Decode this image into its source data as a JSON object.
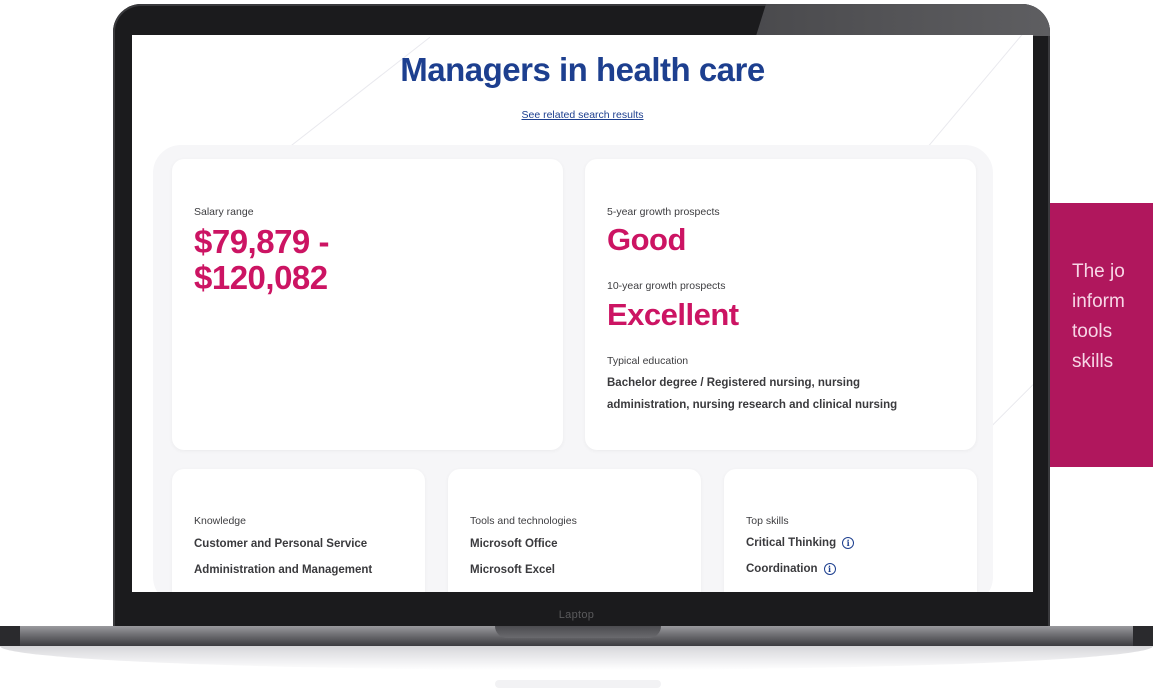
{
  "device": {
    "bezel_label": "Laptop"
  },
  "page": {
    "title": "Managers in health care",
    "related_link": "See related search results"
  },
  "salary": {
    "label": "Salary range",
    "line1": "$79,879 -",
    "line2": "$120,082"
  },
  "growth": {
    "five_label": "5-year growth prospects",
    "five_value": "Good",
    "ten_label": "10-year growth prospects",
    "ten_value": "Excellent",
    "education_label": "Typical education",
    "education_line1": "Bachelor degree / Registered nursing, nursing",
    "education_line2": "administration, nursing research and clinical nursing"
  },
  "knowledge": {
    "label": "Knowledge",
    "items": [
      "Customer and Personal Service",
      "Administration and Management"
    ]
  },
  "tools": {
    "label": "Tools and technologies",
    "items": [
      "Microsoft Office",
      "Microsoft Excel"
    ]
  },
  "skills": {
    "label": "Top skills",
    "items": [
      "Critical Thinking",
      "Coordination"
    ],
    "info_icon": "info-icon"
  },
  "side_panel": {
    "lines": [
      "The jo",
      "inform",
      "tools",
      "skills"
    ]
  },
  "colors": {
    "title_blue": "#1d3f8f",
    "accent_pink": "#cc1463",
    "panel_magenta": "#b0175d"
  }
}
